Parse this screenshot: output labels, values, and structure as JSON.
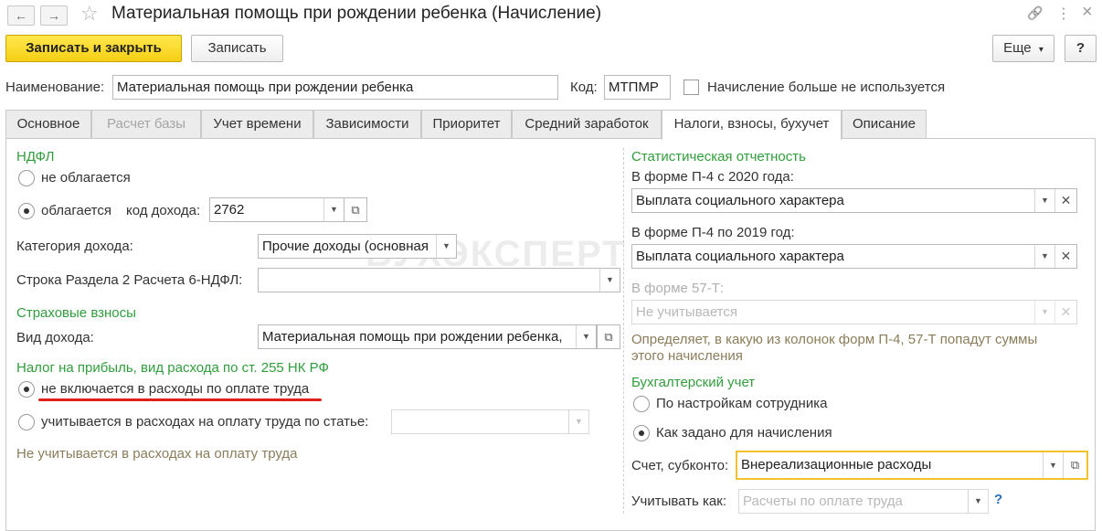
{
  "window": {
    "title": "Материальная помощь при рождении ребенка (Начисление)",
    "back_icon": "←",
    "forward_icon": "→",
    "star_icon": "☆",
    "link_icon": "🔗",
    "menu_icon": "⋮",
    "maximize_icon": "□",
    "close_icon": "×"
  },
  "toolbar": {
    "save_close_label": "Записать и закрыть",
    "save_label": "Записать",
    "more_label": "Еще",
    "more_arrow": "▾",
    "help_label": "?"
  },
  "header": {
    "name_label": "Наименование:",
    "name_value": "Материальная помощь при рождении ребенка",
    "code_label": "Код:",
    "code_value": "МТПМР",
    "unused_label": "Начисление больше не используется"
  },
  "tabs": [
    {
      "label": "Основное"
    },
    {
      "label": "Расчет базы"
    },
    {
      "label": "Учет времени"
    },
    {
      "label": "Зависимости"
    },
    {
      "label": "Приоритет"
    },
    {
      "label": "Средний заработок"
    },
    {
      "label": "Налоги, взносы, бухучет"
    },
    {
      "label": "Описание"
    }
  ],
  "ndfl": {
    "section_title": "НДФЛ",
    "not_taxed_label": "не облагается",
    "taxed_label": "облагается",
    "income_code_label": "код дохода:",
    "income_code_value": "2762",
    "income_category_label": "Категория дохода:",
    "income_category_value": "Прочие доходы (основная",
    "line_6ndfl_label": "Строка Раздела 2 Расчета 6-НДФЛ:",
    "line_6ndfl_value": ""
  },
  "insurance": {
    "section_title": "Страховые взносы",
    "income_type_label": "Вид дохода:",
    "income_type_value": "Материальная помощь при рождении ребенка,"
  },
  "profit_tax": {
    "section_title": "Налог на прибыль, вид расхода по ст. 255 НК РФ",
    "not_included_label": "не включается в расходы по оплате труда",
    "included_label": "учитывается в расходах на оплату труда по статье:",
    "article_value": "",
    "hint": "Не учитывается в расходах на оплату труда"
  },
  "statistics": {
    "section_title": "Статистическая отчетность",
    "p4_2020_label": "В форме П-4 с 2020 года:",
    "p4_2020_value": "Выплата социального характера",
    "p4_2019_label": "В форме П-4 по 2019 год:",
    "p4_2019_value": "Выплата социального характера",
    "f57t_label": "В форме 57-Т:",
    "f57t_value": "Не учитывается",
    "hint_line1": "Определяет, в какую из колонок форм П-4, 57-Т попадут суммы",
    "hint_line2": "этого начисления"
  },
  "accounting": {
    "section_title": "Бухгалтерский учет",
    "by_employee_label": "По настройкам сотрудника",
    "as_set_label": "Как задано для начисления",
    "account_label": "Счет, субконто:",
    "account_value": "Внереализационные расходы",
    "consider_as_label": "Учитывать как:",
    "consider_as_placeholder": "Расчеты по оплате труда",
    "help_mark": "?"
  },
  "watermark": "БУХЭКСПЕРТ",
  "colors": {
    "primary_button": "#f5cf14",
    "section_title": "#2f9e3b",
    "hint_text": "#8a7d5a",
    "underline": "#e0201c"
  }
}
